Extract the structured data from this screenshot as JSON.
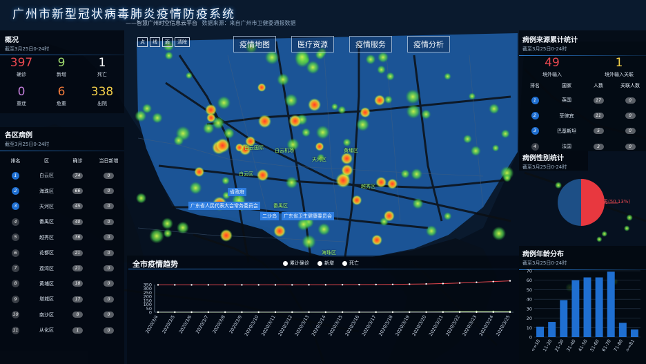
{
  "header": {
    "title": "广州市新型冠状病毒肺炎疫情防疫系统",
    "subtitle": "——智慧广州时空信息云平台",
    "source": "数据来源：来自广州市卫健委通报数据"
  },
  "map_tools": [
    "点",
    "线",
    "面",
    "清除"
  ],
  "nav_tabs": [
    "疫情地图",
    "医疗资源",
    "疫情服务",
    "疫情分析"
  ],
  "map_labels": [
    "白云机场",
    "省政府",
    "广东省人民代表大会常务委员会",
    "广东省卫生健康委员会",
    "广东省政协委员会"
  ],
  "map_green_labels": [
    "白云国际",
    "白云机场",
    "白云区",
    "天河区",
    "黄埔区",
    "越秀区",
    "番禺区",
    "海珠区"
  ],
  "overview": {
    "title": "概况",
    "date": "截至3月25日0-24时",
    "stats": [
      {
        "value": "397",
        "label": "确诊",
        "color": "#e8484f"
      },
      {
        "value": "9",
        "label": "新增",
        "color": "#9bd66c"
      },
      {
        "value": "1",
        "label": "死亡",
        "color": "#ffffff"
      },
      {
        "value": "0",
        "label": "重症",
        "color": "#c07cd8"
      },
      {
        "value": "6",
        "label": "危重",
        "color": "#f07a3a"
      },
      {
        "value": "338",
        "label": "出院",
        "color": "#f3d04a"
      }
    ]
  },
  "district": {
    "title": "各区病例",
    "date": "截至3月25日0-24时",
    "headers": [
      "排名",
      "区",
      "确诊",
      "当日新增"
    ],
    "rows": [
      {
        "rank": "1",
        "name": "白云区",
        "confirmed": "74",
        "new": "0"
      },
      {
        "rank": "2",
        "name": "海珠区",
        "confirmed": "66",
        "new": "0"
      },
      {
        "rank": "3",
        "name": "天河区",
        "confirmed": "45",
        "new": "0"
      },
      {
        "rank": "4",
        "name": "番禺区",
        "confirmed": "40",
        "new": "0"
      },
      {
        "rank": "5",
        "name": "越秀区",
        "confirmed": "36",
        "new": "0"
      },
      {
        "rank": "6",
        "name": "花都区",
        "confirmed": "21",
        "new": "0"
      },
      {
        "rank": "7",
        "name": "荔湾区",
        "confirmed": "21",
        "new": "0"
      },
      {
        "rank": "8",
        "name": "黄埔区",
        "confirmed": "18",
        "new": "0"
      },
      {
        "rank": "9",
        "name": "增城区",
        "confirmed": "17",
        "new": "0"
      },
      {
        "rank": "10",
        "name": "南沙区",
        "confirmed": "8",
        "new": "0"
      },
      {
        "rank": "11",
        "name": "从化区",
        "confirmed": "1",
        "new": "0"
      }
    ]
  },
  "source_stats": {
    "title": "病例来源累计统计",
    "date": "截至3月25日0-24时",
    "imported": {
      "value": "49",
      "label": "境外输入"
    },
    "related": {
      "value": "1",
      "label": "境外输入关联"
    },
    "headers": [
      "排名",
      "国家",
      "人数",
      "关联人数"
    ],
    "rows": [
      {
        "rank": "1",
        "name": "英国",
        "count": "17",
        "related": "0"
      },
      {
        "rank": "2",
        "name": "菲律宾",
        "count": "11",
        "related": "0"
      },
      {
        "rank": "3",
        "name": "巴基斯坦",
        "count": "5",
        "related": "0"
      },
      {
        "rank": "4",
        "name": "法国",
        "count": "3",
        "related": "0"
      }
    ]
  },
  "gender": {
    "title": "病例性别统计",
    "date": "截至3月25日0-24时",
    "label": "男(50.13%)",
    "male_pct": 50.13
  },
  "age": {
    "title": "病例年龄分布",
    "date": "截至3月25日0-24时"
  },
  "trend": {
    "title": "全市疫情趋势",
    "legend": [
      "累计确诊",
      "新增",
      "死亡"
    ]
  },
  "chart_data": [
    {
      "type": "line",
      "title": "全市疫情趋势",
      "x": [
        "2020/3/4",
        "2020/3/5",
        "2020/3/6",
        "2020/3/7",
        "2020/3/8",
        "2020/3/9",
        "2020/3/10",
        "2020/3/11",
        "2020/3/12",
        "2020/3/13",
        "2020/3/14",
        "2020/3/15",
        "2020/3/16",
        "2020/3/17",
        "2020/3/18",
        "2020/3/19",
        "2020/3/20",
        "2020/3/21",
        "2020/3/22",
        "2020/3/23",
        "2020/3/24",
        "2020/3/25"
      ],
      "series": [
        {
          "name": "累计确诊",
          "values": [
            346,
            346,
            346,
            346,
            346,
            346,
            346,
            346,
            346,
            347,
            347,
            348,
            349,
            350,
            352,
            355,
            358,
            363,
            370,
            379,
            388,
            397
          ]
        },
        {
          "name": "新增",
          "values": [
            0,
            0,
            0,
            0,
            0,
            0,
            0,
            0,
            0,
            1,
            0,
            1,
            1,
            1,
            2,
            3,
            3,
            5,
            7,
            9,
            9,
            9
          ]
        },
        {
          "name": "死亡",
          "values": [
            1,
            1,
            1,
            1,
            1,
            1,
            1,
            1,
            1,
            1,
            1,
            1,
            1,
            1,
            1,
            1,
            1,
            1,
            1,
            1,
            1,
            1
          ]
        }
      ],
      "ylim": [
        0,
        350
      ],
      "yticks": [
        0,
        50,
        100,
        150,
        200,
        250,
        300,
        350
      ]
    },
    {
      "type": "bar",
      "title": "病例年龄分布",
      "categories": [
        "<=10",
        "11-20",
        "21-30",
        "31-40",
        "41-50",
        "51-60",
        "61-70",
        "71-80",
        ">=81"
      ],
      "values": [
        11,
        16,
        39,
        60,
        63,
        63,
        69,
        15,
        8
      ],
      "ylim": [
        0,
        70
      ],
      "yticks": [
        0,
        10,
        20,
        30,
        40,
        50,
        60,
        70
      ]
    },
    {
      "type": "pie",
      "title": "病例性别统计",
      "categories": [
        "男",
        "女"
      ],
      "values": [
        50.13,
        49.87
      ]
    }
  ],
  "colors": {
    "accent": "#2a7bd0",
    "confirmed": "#e8484f",
    "bar": "#1f6fd1"
  }
}
